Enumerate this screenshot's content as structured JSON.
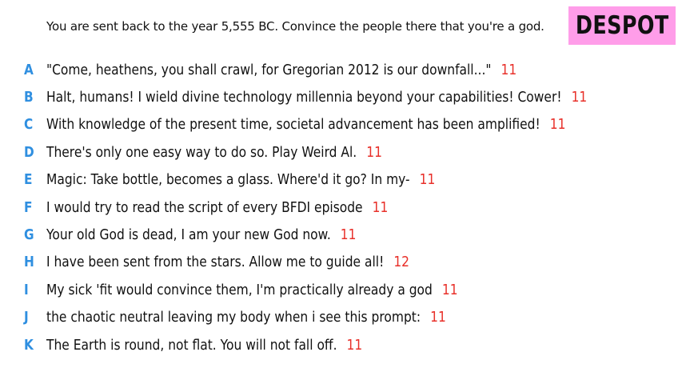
{
  "prompt": "You are sent back to the year 5,555 BC. Convince the people there that you're a god.",
  "title": "DESPOT",
  "colors": {
    "title_bg": "#ff9de9",
    "letter": "#2f8fe0",
    "score": "#e8302a"
  },
  "entries": [
    {
      "letter": "A",
      "text": "\"Come, heathens, you shall crawl, for Gregorian 2012 is our downfall...\"",
      "score": "11"
    },
    {
      "letter": "B",
      "text": "Halt, humans! I wield divine technology millennia beyond your capabilities! Cower!",
      "score": "11"
    },
    {
      "letter": "C",
      "text": "With knowledge of the present time, societal advancement has been amplified!",
      "score": "11"
    },
    {
      "letter": "D",
      "text": "There's only one easy way to do so. Play Weird Al.",
      "score": "11"
    },
    {
      "letter": "E",
      "text": "Magic: Take bottle, becomes a glass. Where'd it go? In my-",
      "score": "11"
    },
    {
      "letter": "F",
      "text": "I would try to read the script of every BFDI episode",
      "score": "11"
    },
    {
      "letter": "G",
      "text": "Your old God is dead, I am your new God now.",
      "score": "11"
    },
    {
      "letter": "H",
      "text": "I have been sent from the stars. Allow me to guide all!",
      "score": "12"
    },
    {
      "letter": "I",
      "text": "My sick 'fit would convince them, I'm practically already a god",
      "score": "11"
    },
    {
      "letter": "J",
      "text": "the chaotic neutral leaving my body when i see this prompt:",
      "score": "11"
    },
    {
      "letter": "K",
      "text": "The Earth is round, not flat. You will not fall off.",
      "score": "11"
    }
  ]
}
